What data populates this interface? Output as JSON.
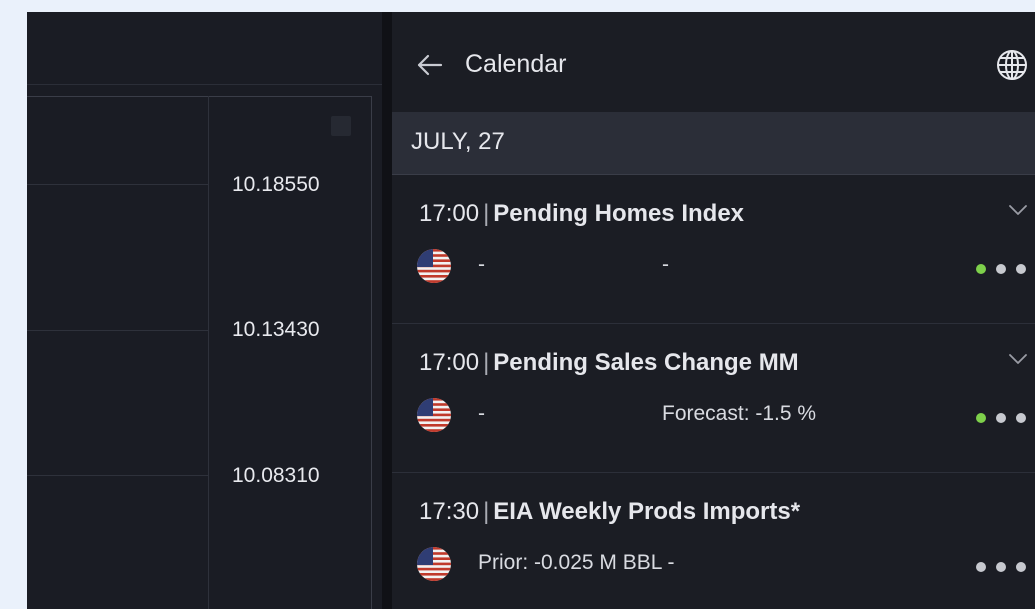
{
  "chart": {
    "price_labels": [
      "10.18550",
      "10.13430",
      "10.08310"
    ]
  },
  "calendar": {
    "title": "Calendar",
    "back_icon": "arrow-left-icon",
    "globe_icon": "globe-icon",
    "date": "JULY, 27",
    "events": [
      {
        "time": "17:00",
        "name": "Pending Homes Index",
        "left": "-",
        "mid": "-",
        "impact_active_color": "#7ed04b"
      },
      {
        "time": "17:00",
        "name": "Pending Sales Change MM",
        "left": "-",
        "mid": "Forecast: -1.5 %",
        "impact_active_color": "#7ed04b"
      },
      {
        "time": "17:30",
        "name": "EIA Weekly Prods Imports*",
        "left": "Prior: -0.025 M BBL -",
        "mid": "",
        "impact_active_color": "#c7c9cf"
      }
    ]
  },
  "colors": {
    "background": "#1b1d24",
    "date_bar": "#2b2e38",
    "impact_green": "#7ed04b",
    "impact_grey": "#c7c9cf"
  }
}
